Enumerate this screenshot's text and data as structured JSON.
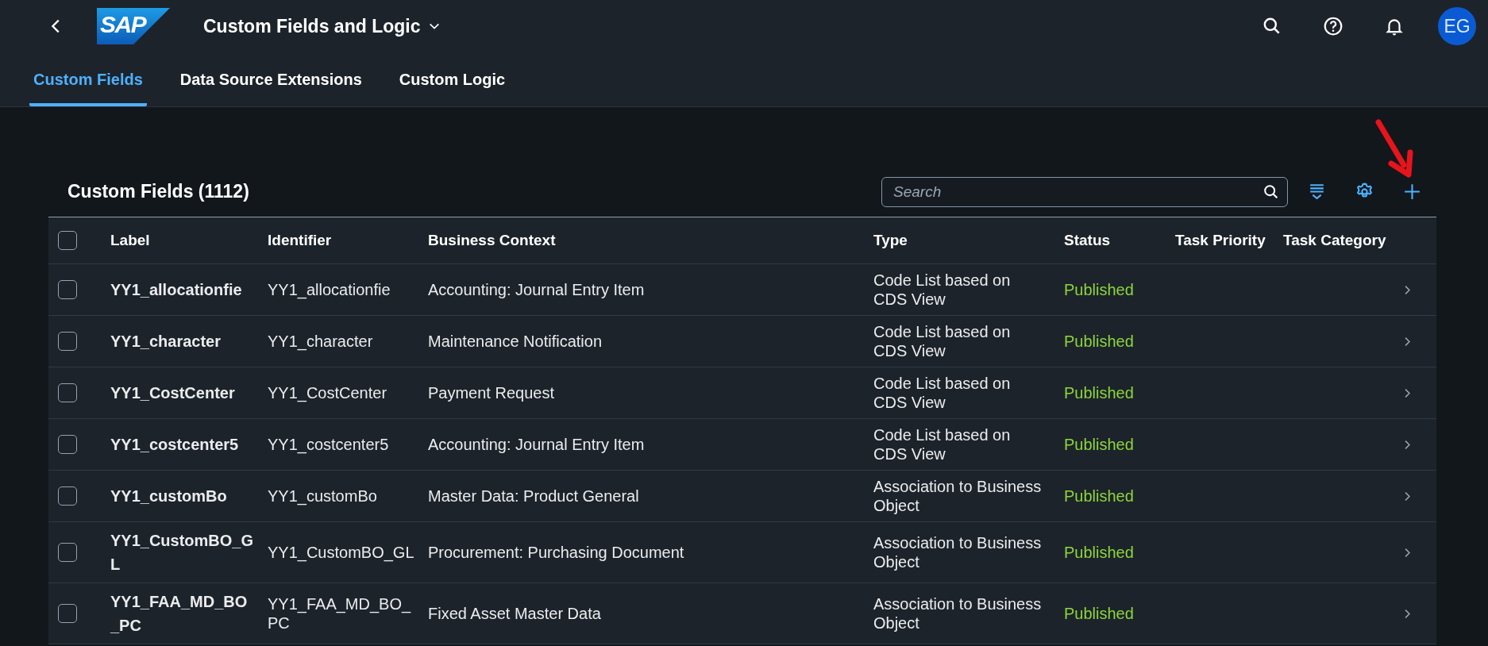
{
  "shell": {
    "logo": "SAP",
    "title": "Custom Fields and Logic",
    "avatar": "EG"
  },
  "tabs": [
    {
      "label": "Custom Fields",
      "selected": true
    },
    {
      "label": "Data Source Extensions",
      "selected": false
    },
    {
      "label": "Custom Logic",
      "selected": false
    }
  ],
  "table": {
    "title": "Custom Fields (1112)",
    "search": {
      "placeholder": "Search"
    },
    "select_all_checked": false,
    "columns": [
      "Label",
      "Identifier",
      "Business Context",
      "Type",
      "Status",
      "Task Priority",
      "Task Category"
    ],
    "rows": [
      {
        "checked": false,
        "label": "YY1_allocationfie",
        "identifier": "YY1_allocationfie",
        "context": "Accounting: Journal Entry Item",
        "type": "Code List based on CDS View",
        "status": "Published"
      },
      {
        "checked": false,
        "label": "YY1_character",
        "identifier": "YY1_character",
        "context": "Maintenance Notification",
        "type": "Code List based on CDS View",
        "status": "Published"
      },
      {
        "checked": false,
        "label": "YY1_CostCenter",
        "identifier": "YY1_CostCenter",
        "context": "Payment Request",
        "type": "Code List based on CDS View",
        "status": "Published"
      },
      {
        "checked": false,
        "label": "YY1_costcenter5",
        "identifier": "YY1_costcenter5",
        "context": "Accounting: Journal Entry Item",
        "type": "Code List based on CDS View",
        "status": "Published"
      },
      {
        "checked": false,
        "label": "YY1_customBo",
        "identifier": "YY1_customBo",
        "context": "Master Data: Product General",
        "type": "Association to Business Object",
        "status": "Published"
      },
      {
        "checked": false,
        "label": "YY1_CustomBO_GL",
        "identifier": "YY1_CustomBO_GL",
        "context": "Procurement: Purchasing Document",
        "type": "Association to Business Object",
        "status": "Published"
      },
      {
        "checked": false,
        "label": "YY1_FAA_MD_BO_PC",
        "identifier": "YY1_FAA_MD_BO_PC",
        "context": "Fixed Asset Master Data",
        "type": "Association to Business Object",
        "status": "Published"
      }
    ]
  }
}
